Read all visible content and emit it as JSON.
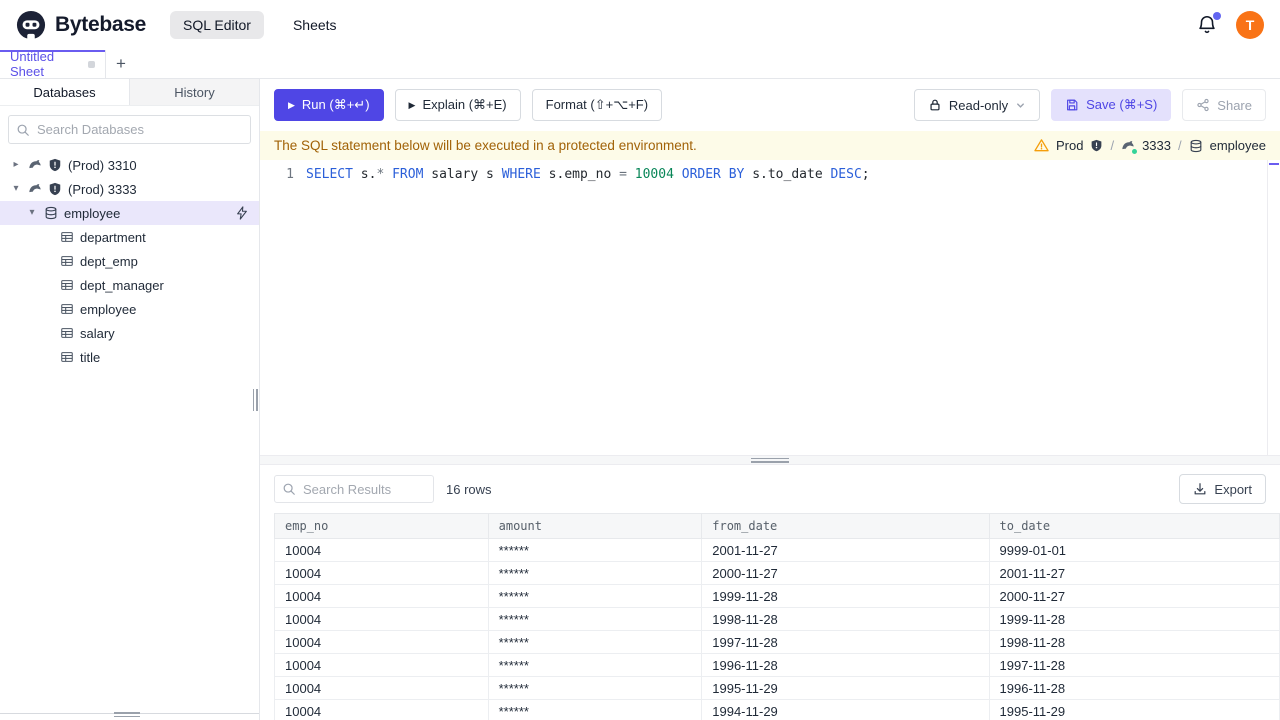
{
  "colors": {
    "accent": "#4f46e5",
    "accent_light": "#e4e1fc",
    "brand_dark": "#1c2236",
    "warning_bg": "#fdfbe8",
    "warning_text": "#a16207",
    "avatar_bg": "#f97316",
    "sql_keyword": "#2b5fd9",
    "sql_number": "#098658"
  },
  "header": {
    "brand": "Bytebase",
    "nav": [
      {
        "label": "SQL Editor",
        "active": true
      },
      {
        "label": "Sheets",
        "active": false
      }
    ],
    "notification_dot": true,
    "avatar_letter": "T"
  },
  "sheet_tabs": {
    "active_tab": "Untitled Sheet",
    "add_button": "+"
  },
  "sidebar": {
    "tabs": [
      {
        "label": "Databases",
        "active": true
      },
      {
        "label": "History",
        "active": false
      }
    ],
    "search_placeholder": "Search Databases",
    "tree": [
      {
        "label": "(Prod) 3310",
        "icon": "mysql",
        "depth": 0,
        "arrow": "collapsed",
        "shield": true
      },
      {
        "label": "(Prod) 3333",
        "icon": "mysql",
        "depth": 0,
        "arrow": "expanded",
        "shield": true
      },
      {
        "label": "employee",
        "icon": "database",
        "depth": 1,
        "arrow": "expanded",
        "selected": true,
        "trailing_icon": "bolt"
      },
      {
        "label": "department",
        "icon": "table",
        "depth": 2
      },
      {
        "label": "dept_emp",
        "icon": "table",
        "depth": 2
      },
      {
        "label": "dept_manager",
        "icon": "table",
        "depth": 2
      },
      {
        "label": "employee",
        "icon": "table",
        "depth": 2
      },
      {
        "label": "salary",
        "icon": "table",
        "depth": 2
      },
      {
        "label": "title",
        "icon": "table",
        "depth": 2
      }
    ]
  },
  "toolbar": {
    "run_label": "Run (⌘+↵)",
    "explain_label": "Explain (⌘+E)",
    "format_label": "Format (⇧+⌥+F)",
    "readonly_label": "Read-only",
    "save_label": "Save (⌘+S)",
    "share_label": "Share"
  },
  "banner": {
    "message": "The SQL statement below will be executed in a protected environment.",
    "breadcrumb": {
      "environment": "Prod",
      "instance": "3333",
      "database": "employee",
      "separator": "/"
    }
  },
  "editor": {
    "line_number": "1",
    "sql_text": "SELECT s.* FROM salary s WHERE s.emp_no = 10004 ORDER BY s.to_date DESC;",
    "tokens": [
      {
        "text": "SELECT",
        "type": "keyword"
      },
      {
        "text": " s.",
        "type": "plain"
      },
      {
        "text": "*",
        "type": "operator"
      },
      {
        "text": " ",
        "type": "plain"
      },
      {
        "text": "FROM",
        "type": "keyword"
      },
      {
        "text": " salary s ",
        "type": "plain"
      },
      {
        "text": "WHERE",
        "type": "keyword"
      },
      {
        "text": " s.emp_no ",
        "type": "plain"
      },
      {
        "text": "=",
        "type": "operator"
      },
      {
        "text": " ",
        "type": "plain"
      },
      {
        "text": "10004",
        "type": "number"
      },
      {
        "text": " ",
        "type": "plain"
      },
      {
        "text": "ORDER BY",
        "type": "keyword"
      },
      {
        "text": " s.to_date ",
        "type": "plain"
      },
      {
        "text": "DESC",
        "type": "keyword"
      },
      {
        "text": ";",
        "type": "plain"
      }
    ]
  },
  "results": {
    "search_placeholder": "Search Results",
    "row_count": "16 rows",
    "export_label": "Export",
    "table": {
      "columns": [
        "emp_no",
        "amount",
        "from_date",
        "to_date"
      ],
      "rows": [
        [
          "10004",
          "******",
          "2001-11-27",
          "9999-01-01"
        ],
        [
          "10004",
          "******",
          "2000-11-27",
          "2001-11-27"
        ],
        [
          "10004",
          "******",
          "1999-11-28",
          "2000-11-27"
        ],
        [
          "10004",
          "******",
          "1998-11-28",
          "1999-11-28"
        ],
        [
          "10004",
          "******",
          "1997-11-28",
          "1998-11-28"
        ],
        [
          "10004",
          "******",
          "1996-11-28",
          "1997-11-28"
        ],
        [
          "10004",
          "******",
          "1995-11-29",
          "1996-11-28"
        ],
        [
          "10004",
          "******",
          "1994-11-29",
          "1995-11-29"
        ]
      ]
    }
  }
}
